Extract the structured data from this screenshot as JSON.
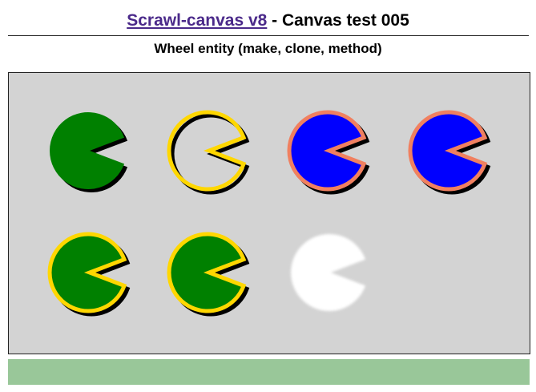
{
  "header": {
    "link_text": "Scrawl-canvas v8",
    "title_rest": " - Canvas test 005",
    "subtitle": "Wheel entity (make, clone, method)"
  },
  "canvas": {
    "background": "#d3d3d3",
    "wheels": [
      {
        "name": "wheel-1",
        "method": "fill",
        "fill": "#008000",
        "stroke": "none",
        "shadow": true,
        "blur": false
      },
      {
        "name": "wheel-2",
        "method": "draw",
        "fill": "none",
        "stroke": "#ffd700",
        "shadow": true,
        "blur": false
      },
      {
        "name": "wheel-3",
        "method": "drawAndFill",
        "fill": "#0000ff",
        "stroke": "#f08060",
        "shadow": true,
        "blur": false
      },
      {
        "name": "wheel-4",
        "method": "fillAndDraw",
        "fill": "#0000ff",
        "stroke": "#f08060",
        "shadow": true,
        "blur": false
      },
      {
        "name": "wheel-5",
        "method": "drawThenFill",
        "fill": "#008000",
        "stroke": "#ffd700",
        "shadow": true,
        "blur": false
      },
      {
        "name": "wheel-6",
        "method": "fillThenDraw",
        "fill": "#008000",
        "stroke": "#ffd700",
        "shadow": true,
        "blur": false
      },
      {
        "name": "wheel-7",
        "method": "clear",
        "fill": "#ffffff",
        "stroke": "none",
        "shadow": false,
        "blur": true
      }
    ]
  },
  "report": {
    "color": "#99c799"
  }
}
